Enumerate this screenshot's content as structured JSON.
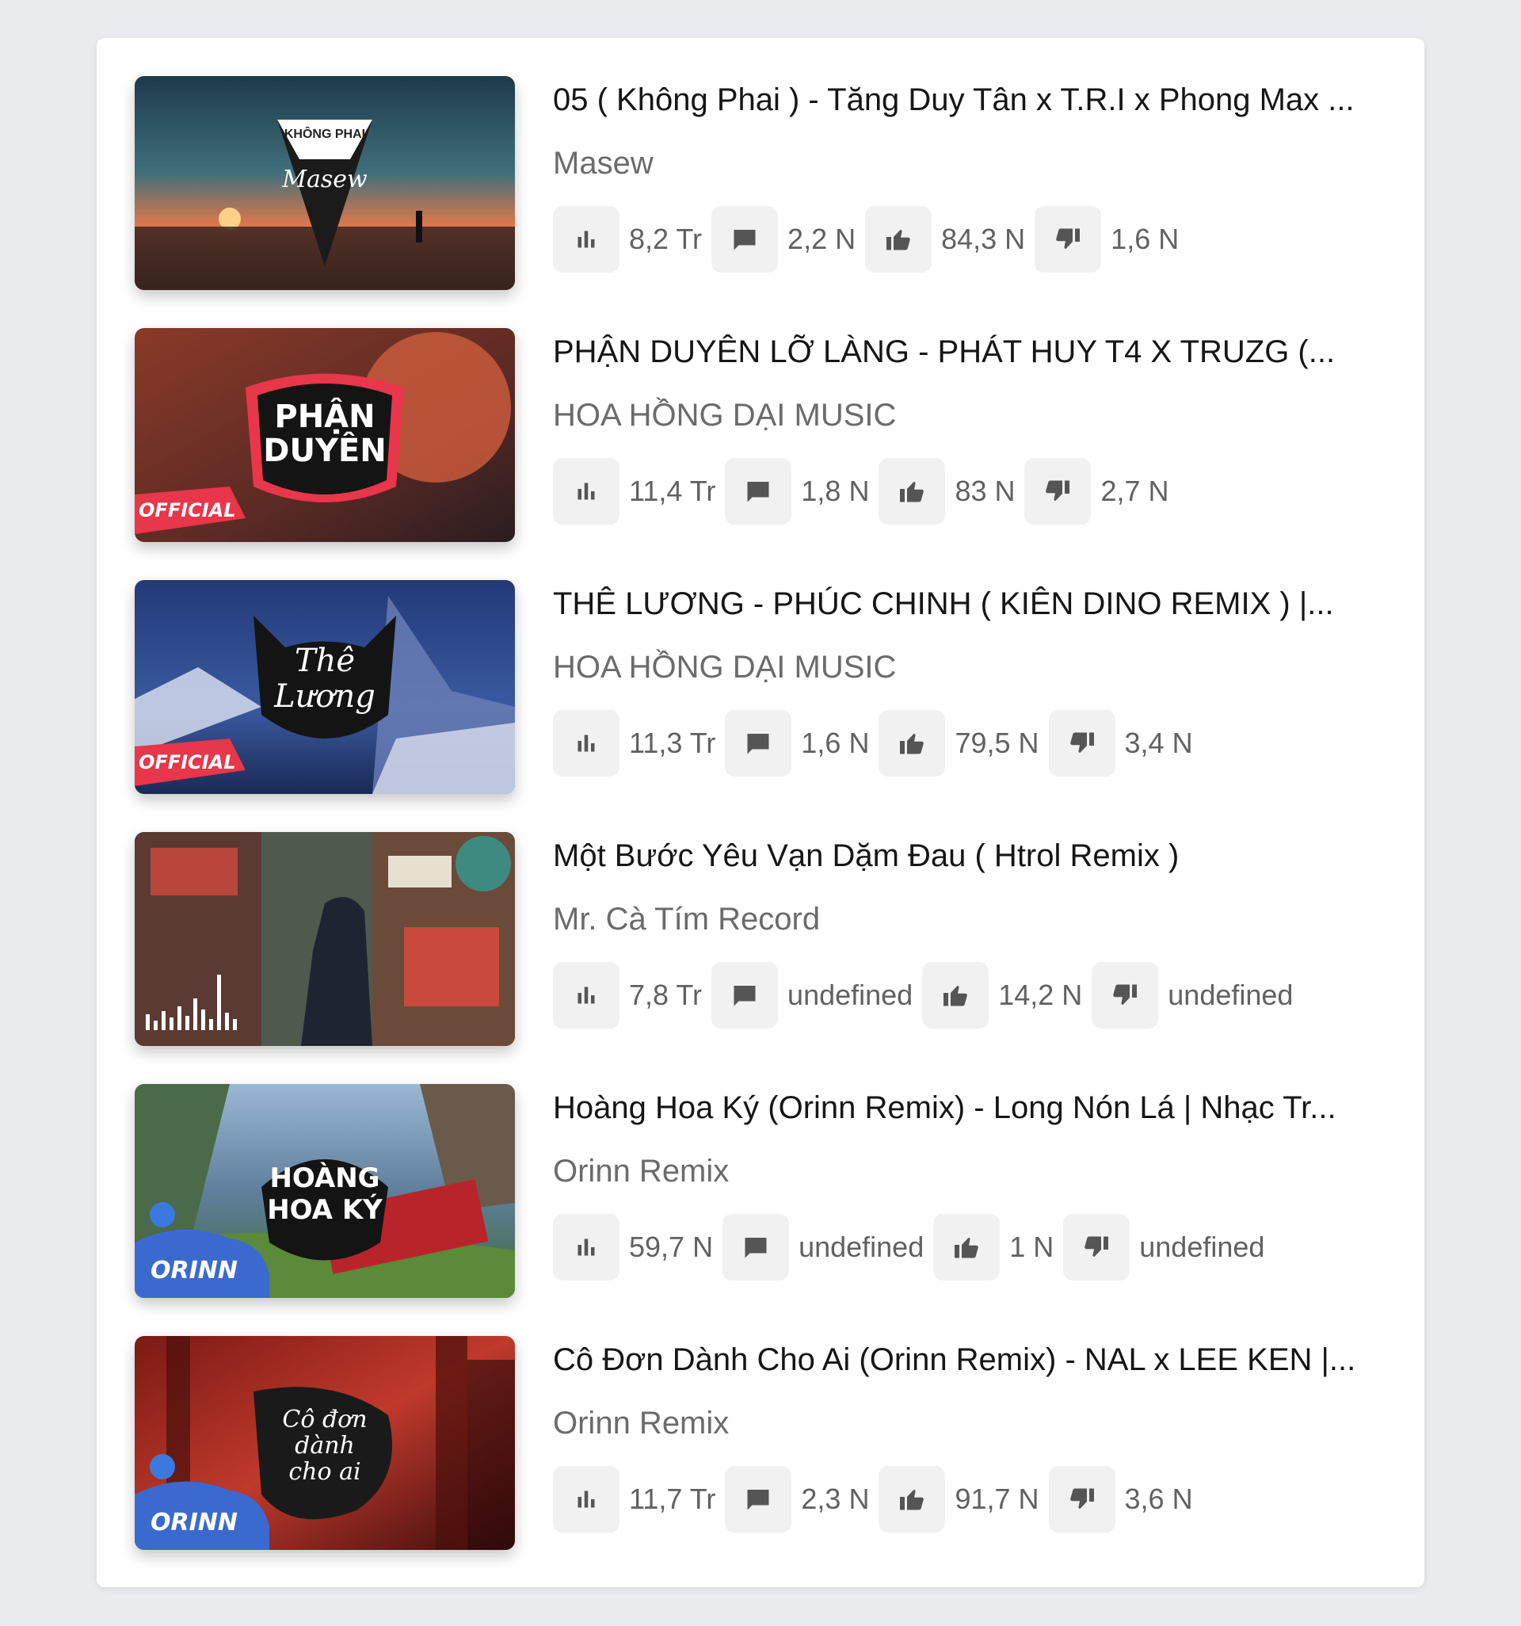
{
  "videos": [
    {
      "title": "05 ( Không Phai ) - Tăng Duy Tân x T.R.I x Phong Max ...",
      "channel": "Masew",
      "views": "8,2 Tr",
      "comments": "2,2 N",
      "likes": "84,3 N",
      "dislikes": "1,6 N",
      "thumb_text": [
        "KHÔNG PHAI",
        "Masew"
      ],
      "thumb_colors": [
        "#1f3b4d",
        "#e2704a"
      ]
    },
    {
      "title": "PHẬN DUYÊN LỠ LÀNG - PHÁT HUY T4 X TRUZG (...",
      "channel": "HOA HỒNG DẠI MUSIC",
      "views": "11,4 Tr",
      "comments": "1,8 N",
      "likes": "83 N",
      "dislikes": "2,7 N",
      "thumb_text": [
        "PHẬN",
        "DUYÊN",
        "OFFICIAL"
      ],
      "thumb_colors": [
        "#7a2e22",
        "#d2603f"
      ]
    },
    {
      "title": "THÊ LƯƠNG - PHÚC CHINH ( KIÊN DINO REMIX ) |...",
      "channel": "HOA HỒNG DẠI MUSIC",
      "views": "11,3 Tr",
      "comments": "1,6 N",
      "likes": "79,5 N",
      "dislikes": "3,4 N",
      "thumb_text": [
        "Thê",
        "Lương",
        "OFFICIAL"
      ],
      "thumb_colors": [
        "#24407a",
        "#c9d2e8"
      ]
    },
    {
      "title": "Một Bước Yêu Vạn Dặm Đau ( Htrol Remix )",
      "channel": "Mr. Cà Tím Record",
      "views": "7,8 Tr",
      "comments": "undefined",
      "likes": "14,2 N",
      "dislikes": "undefined",
      "thumb_text": [],
      "thumb_colors": [
        "#3a3a3a",
        "#b8463a"
      ]
    },
    {
      "title": "Hoàng Hoa Ký (Orinn Remix) - Long Nón Lá | Nhạc Tr...",
      "channel": "Orinn Remix",
      "views": "59,7 N",
      "comments": "undefined",
      "likes": "1 N",
      "dislikes": "undefined",
      "thumb_text": [
        "HOÀNG",
        "HOA KÝ",
        "ORINN"
      ],
      "thumb_colors": [
        "#6a8aa8",
        "#3f6b3a"
      ]
    },
    {
      "title": "Cô Đơn Dành Cho Ai (Orinn Remix) - NAL x LEE KEN |...",
      "channel": "Orinn Remix",
      "views": "11,7 Tr",
      "comments": "2,3 N",
      "likes": "91,7 N",
      "dislikes": "3,6 N",
      "thumb_text": [
        "Cô đơn",
        "dành",
        "cho ai",
        "ORINN"
      ],
      "thumb_colors": [
        "#5a1414",
        "#c0392b"
      ]
    }
  ],
  "icons": {
    "views": "bar-chart-icon",
    "comments": "comment-icon",
    "likes": "thumbs-up-icon",
    "dislikes": "thumbs-down-icon"
  },
  "colors": {
    "background": "#e9ebee",
    "card": "#ffffff",
    "title": "#161616",
    "secondary": "#6b6b6b",
    "stat_button": "#f1f1f1",
    "icon": "#555555"
  }
}
